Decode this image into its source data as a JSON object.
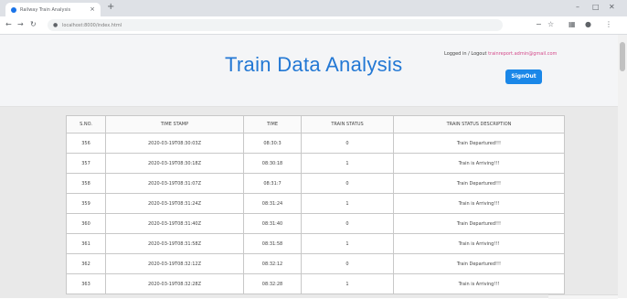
{
  "browser": {
    "tab_title": "Railway Train Analysis",
    "url": "localhost:8000/index.html",
    "new_tab_glyph": "+",
    "close_glyph": "×"
  },
  "header": {
    "title": "Train Data Analysis",
    "login_prefix": "Logged in / Logout ",
    "login_email": "trainreport.admin@gmail.com",
    "signout_label": "SignOut"
  },
  "table": {
    "headers": [
      "S.NO.",
      "TIME STAMP",
      "TIME",
      "TRAIN STATUS",
      "TRAIN STATUS DESCRIPTION"
    ],
    "rows": [
      [
        "356",
        "2020-03-19T08:30:03Z",
        "08:30:3",
        "0",
        "Train Departured!!!"
      ],
      [
        "357",
        "2020-03-19T08:30:18Z",
        "08:30:18",
        "1",
        "Train is Arriving!!!"
      ],
      [
        "358",
        "2020-03-19T08:31:07Z",
        "08:31:7",
        "0",
        "Train Departured!!!"
      ],
      [
        "359",
        "2020-03-19T08:31:24Z",
        "08:31:24",
        "1",
        "Train is Arriving!!!"
      ],
      [
        "360",
        "2020-03-19T08:31:40Z",
        "08:31:40",
        "0",
        "Train Departured!!!"
      ],
      [
        "361",
        "2020-03-19T08:31:58Z",
        "08:31:58",
        "1",
        "Train is Arriving!!!"
      ],
      [
        "362",
        "2020-03-19T08:32:12Z",
        "08:32:12",
        "0",
        "Train Departured!!!"
      ],
      [
        "363",
        "2020-03-19T08:32:28Z",
        "08:32:28",
        "1",
        "Train is Arriving!!!"
      ]
    ]
  },
  "colors": {
    "title": "#2378d4",
    "signout_bg": "#1a87e8",
    "departed": "#2e9a3f",
    "arriving": "#d23030"
  },
  "icons": [
    "back-arrow-icon",
    "forward-arrow-icon",
    "reload-icon",
    "lock-icon",
    "star-icon",
    "menu-icon"
  ]
}
